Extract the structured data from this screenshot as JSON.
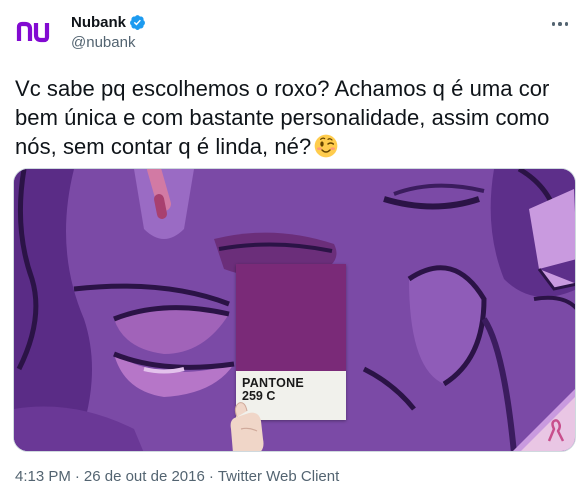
{
  "tweet": {
    "author": {
      "display_name": "Nubank",
      "handle": "@nubank",
      "verified": true,
      "logo_text": "nu",
      "brand_color": "#820ad1"
    },
    "text": "Vc sabe pq escolhemos o roxo? Achamos q é uma cor bem única e com bastante personalidade, assim como nós, sem contar q é linda, né?",
    "emoji": "winking-face",
    "media": {
      "pantone_brand": "PANTONE",
      "pantone_code": "259 C",
      "swatch_color": "#7a2a78",
      "accent_color": "#6e3f98"
    },
    "meta": {
      "time": "4:13 PM",
      "separator": "·",
      "date": "26 de out de 2016",
      "source": "Twitter Web Client"
    },
    "colors": {
      "text": "#0f1419",
      "secondary": "#536471",
      "verified": "#1d9bf0"
    }
  }
}
